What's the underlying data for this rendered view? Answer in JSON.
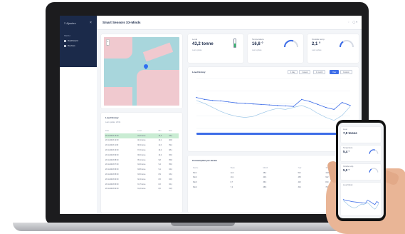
{
  "sidebar": {
    "brand": "≡ Ajoutex",
    "section": "MENU",
    "items": [
      {
        "label": "Dashboard"
      },
      {
        "label": "Devices"
      }
    ]
  },
  "topbar": {
    "title": "Smart Sensors XX-Minds",
    "icons": [
      "bell-icon",
      "user-icon"
    ]
  },
  "kpis": [
    {
      "label": "Level",
      "value": "43,2 tonne",
      "sub": "Last update"
    },
    {
      "label": "Temperature",
      "value": "16,8 °",
      "sub": "Last update"
    },
    {
      "label": "Outside temp.",
      "value": "2,1 °",
      "sub": "Last update"
    }
  ],
  "chart": {
    "title": "Level history",
    "buttons": [
      "1 day",
      "1 week",
      "1 month",
      "Year",
      "Custom"
    ],
    "active_button": 3,
    "colors": {
      "line1": "#3d6de8",
      "line2": "#9fc8e8",
      "bar": "#3d6de8"
    }
  },
  "chart_data": {
    "type": "line",
    "x": [
      "00:00",
      "01:00",
      "02:00",
      "03:00",
      "04:00",
      "05:00",
      "06:00",
      "07:00",
      "08:00",
      "09:00",
      "10:00",
      "11:00",
      "12:00",
      "13:00",
      "14:00",
      "15:00",
      "16:00",
      "17:00",
      "18:00",
      "19:00"
    ],
    "series": [
      {
        "values": [
          62,
          58,
          56,
          55,
          53,
          51,
          50,
          49,
          48,
          47,
          46,
          45,
          44,
          58,
          54,
          48,
          42,
          38,
          52,
          46
        ]
      },
      {
        "values": [
          56,
          50,
          42,
          34,
          28,
          24,
          22,
          24,
          30,
          36,
          40,
          38,
          42,
          46,
          40,
          30,
          22,
          16,
          26,
          44
        ]
      }
    ],
    "ylim": [
      0,
      100
    ],
    "grid": true
  },
  "table": {
    "title": "Level history",
    "sub": "Last update: 20/11",
    "headers": [
      "Date",
      "Level",
      "Min",
      "Max"
    ],
    "rows": [
      [
        "20.11.2023 13:00",
        "43,2 tonne",
        "12,3",
        "43,2"
      ],
      [
        "20.11.2023 12:00",
        "40,1 tonne",
        "10,1",
        "40,8"
      ],
      [
        "20.11.2023 11:00",
        "38,4 tonne",
        "11,0",
        "39,2"
      ],
      [
        "20.11.2023 10:00",
        "37,2 tonne",
        "10,4",
        "38,1"
      ],
      [
        "20.11.2023 09:00",
        "36,0 tonne",
        "10,2",
        "36,6"
      ],
      [
        "20.11.2023 08:00",
        "35,1 tonne",
        "9,8",
        "35,8"
      ],
      [
        "20.11.2023 07:00",
        "34,6 tonne",
        "9,4",
        "35,0"
      ],
      [
        "20.11.2023 06:00",
        "33,8 tonne",
        "9,1",
        "34,2"
      ],
      [
        "20.11.2023 05:00",
        "33,0 tonne",
        "8,9",
        "33,4"
      ],
      [
        "20.11.2023 04:00",
        "32,4 tonne",
        "8,6",
        "32,9"
      ],
      [
        "20.11.2023 03:00",
        "31,7 tonne",
        "8,2",
        "32,1"
      ],
      [
        "20.11.2023 02:00",
        "31,2 tonne",
        "8,0",
        "31,5"
      ]
    ],
    "highlight_row": 0
  },
  "table2": {
    "title": "Consumption per device",
    "headers": [
      "Device",
      "Week",
      "Month",
      "Year",
      "Total"
    ],
    "rows": [
      [
        "Silo 1",
        "12,4",
        "48,2",
        "512",
        "1024"
      ],
      [
        "Silo 2",
        "10,1",
        "40,6",
        "468",
        "942"
      ],
      [
        "Silo 3",
        "8,7",
        "36,3",
        "402",
        "810"
      ],
      [
        "Silo 4",
        "7,2",
        "28,8",
        "344",
        "702"
      ]
    ]
  },
  "phone": {
    "kpis": [
      {
        "label": "Level",
        "value": "7,9 tonne"
      },
      {
        "label": "Temperature",
        "value": "5,4 °"
      },
      {
        "label": "Outside temp.",
        "value": "5,0 °"
      }
    ],
    "chart_title": "Level history"
  }
}
